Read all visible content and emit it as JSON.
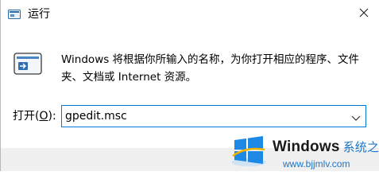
{
  "window": {
    "title": "运行",
    "close_icon": "close-icon",
    "app_icon": "run-icon"
  },
  "main": {
    "description": "Windows 将根据你所输入的名称，为你打开相应的程序、文件夹、文档或 Internet 资源。",
    "open_label": "打开(",
    "open_label_accel": "O",
    "open_label_suffix": "):",
    "command_value": "gpedit.msc"
  },
  "watermark": {
    "brand": "Windows",
    "brand_cn": "系统之家",
    "url": "www.bjjmlv.com"
  },
  "colors": {
    "focus_border": "#0078d7",
    "watermark_blue": "#1a75c9"
  }
}
